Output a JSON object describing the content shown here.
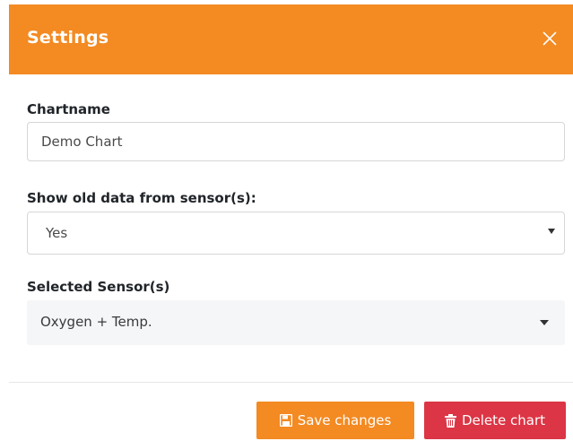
{
  "dialog": {
    "title": "Settings",
    "colors": {
      "accent": "#f38a22",
      "danger": "#dc3545"
    }
  },
  "chartname": {
    "label": "Chartname",
    "value": "Demo Chart"
  },
  "old_data": {
    "label": "Show old data from sensor(s):",
    "selected": "Yes"
  },
  "sensors": {
    "label": "Selected Sensor(s)",
    "selected": "Oxygen + Temp."
  },
  "footer": {
    "save_label": "Save changes",
    "save_icon": "floppy-disk-icon",
    "delete_label": "Delete chart",
    "delete_icon": "trash-icon"
  }
}
